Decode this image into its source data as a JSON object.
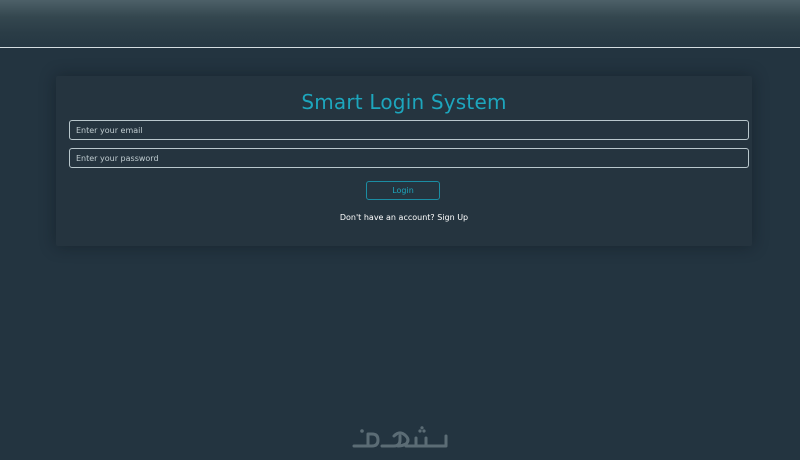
{
  "app": {
    "title": "Smart Login System"
  },
  "form": {
    "email_placeholder": "Enter your email",
    "email_value": "",
    "password_placeholder": "Enter your password",
    "password_value": "",
    "login_label": "Login",
    "signup_prompt": "Don't have an account?",
    "signup_link": "Sign Up"
  },
  "watermark": {
    "text": "خمسات",
    "icon": "khamsat-logo"
  },
  "colors": {
    "background": "#233440",
    "accent": "#1da6bd",
    "border": "#b9c7cc",
    "text": "#ffffff"
  }
}
